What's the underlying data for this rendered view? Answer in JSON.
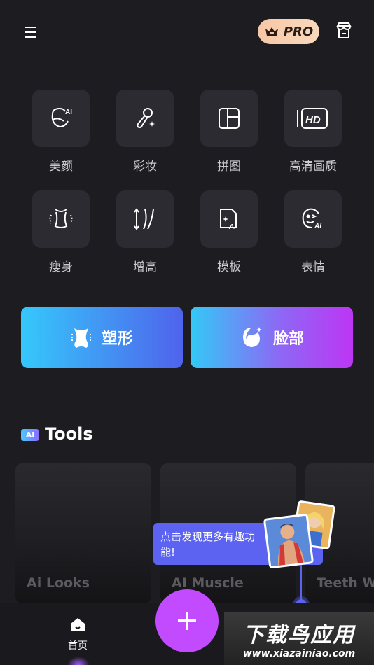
{
  "header": {
    "menu_icon": "hamburger-icon",
    "pro_label": "PRO",
    "store_icon": "store-icon"
  },
  "tools_grid": [
    {
      "label": "美颜",
      "icon": "ai-face-icon"
    },
    {
      "label": "彩妆",
      "icon": "makeup-brush-icon"
    },
    {
      "label": "拼图",
      "icon": "collage-icon"
    },
    {
      "label": "高清画质",
      "icon": "hd-icon"
    },
    {
      "label": "瘦身",
      "icon": "slim-body-icon"
    },
    {
      "label": "增高",
      "icon": "height-icon"
    },
    {
      "label": "模板",
      "icon": "ai-template-icon"
    },
    {
      "label": "表情",
      "icon": "ai-expression-icon"
    }
  ],
  "big_buttons": [
    {
      "label": "塑形",
      "icon": "body-shape-icon"
    },
    {
      "label": "脸部",
      "icon": "face-icon"
    }
  ],
  "ai_section": {
    "chip": "AI",
    "title": "Tools",
    "cards": [
      "Ai Looks",
      "AI Muscle",
      "Teeth Wh"
    ]
  },
  "tooltip": {
    "text": "点击发现更多有趣功能!"
  },
  "bottom_nav": {
    "home_label": "首页",
    "fab_icon": "plus-icon"
  },
  "watermark": {
    "title": "下载鸟应用",
    "url": "www.xiazainiao.com"
  },
  "colors": {
    "background": "#1d1c21",
    "accent": "#c24bff",
    "tooltip": "#5b63f0"
  }
}
